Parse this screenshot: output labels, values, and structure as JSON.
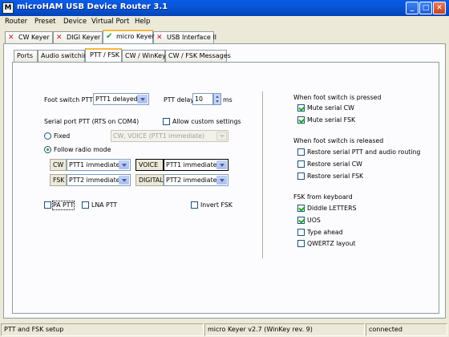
{
  "window": {
    "title": "microHAM USB Device Router 3.1",
    "app_icon": "microham-app-icon",
    "controls": {
      "minimize": "_",
      "maximize": "□",
      "close": "✕"
    }
  },
  "menu": [
    "Router",
    "Preset",
    "Device",
    "Virtual Port",
    "Help"
  ],
  "device_tabs": [
    {
      "label": "CW Keyer",
      "icon": "x-icon",
      "active": false
    },
    {
      "label": "DIGI Keyer",
      "icon": "x-icon",
      "active": false
    },
    {
      "label": "micro Keyer",
      "icon": "check-icon",
      "active": true
    },
    {
      "label": "USB Interface II",
      "icon": "x-icon",
      "active": false
    }
  ],
  "sub_tabs": [
    {
      "label": "Ports",
      "active": false
    },
    {
      "label": "Audio switching",
      "active": false
    },
    {
      "label": "PTT / FSK",
      "active": true
    },
    {
      "label": "CW / WinKey",
      "active": false
    },
    {
      "label": "CW / FSK Messages",
      "active": false
    }
  ],
  "ptt": {
    "foot_switch_label": "Foot switch PTT",
    "foot_switch_value": "PTT1 delayed",
    "delay_label": "PTT delay",
    "delay_value": "10",
    "delay_unit": "ms",
    "serial_port_label": "Serial port PTT (RTS on COM4)",
    "allow_custom_label": "Allow custom settings",
    "allow_custom_checked": false,
    "fixed_label": "Fixed",
    "fixed_value": "CW, VOICE  (PTT1 immediate)",
    "follow_label": "Follow radio mode",
    "mode_selected": "follow",
    "modes": [
      {
        "mode": "CW",
        "value": "PTT1 immediate"
      },
      {
        "mode": "FSK",
        "value": "PTT2 immediate"
      },
      {
        "mode": "VOICE",
        "value": "PTT1 immediate"
      },
      {
        "mode": "DIGITAL",
        "value": "PTT2 immediate"
      }
    ],
    "pa_ptt_label": "PA PTT",
    "pa_ptt_checked": false,
    "lna_ptt_label": "LNA PTT",
    "lna_ptt_checked": false,
    "invert_fsk_label": "Invert FSK",
    "invert_fsk_checked": false
  },
  "pressed": {
    "heading": "When foot switch is pressed",
    "items": [
      {
        "label": "Mute serial CW",
        "checked": true
      },
      {
        "label": "Mute serial FSK",
        "checked": true
      }
    ]
  },
  "released": {
    "heading": "When foot switch is released",
    "items": [
      {
        "label": "Restore serial PTT and audio routing",
        "checked": false
      },
      {
        "label": "Restore serial CW",
        "checked": false
      },
      {
        "label": "Restore serial FSK",
        "checked": false
      }
    ]
  },
  "fsk_keyboard": {
    "heading": "FSK from keyboard",
    "items": [
      {
        "label": "Diddle LETTERS",
        "checked": true
      },
      {
        "label": "UOS",
        "checked": true
      },
      {
        "label": "Type ahead",
        "checked": false
      },
      {
        "label": "QWERTZ layout",
        "checked": false
      }
    ]
  },
  "statusbar": {
    "left": "PTT and FSK setup",
    "middle": "micro Keyer v2.7 (WinKey rev. 9)",
    "right": "connected"
  }
}
